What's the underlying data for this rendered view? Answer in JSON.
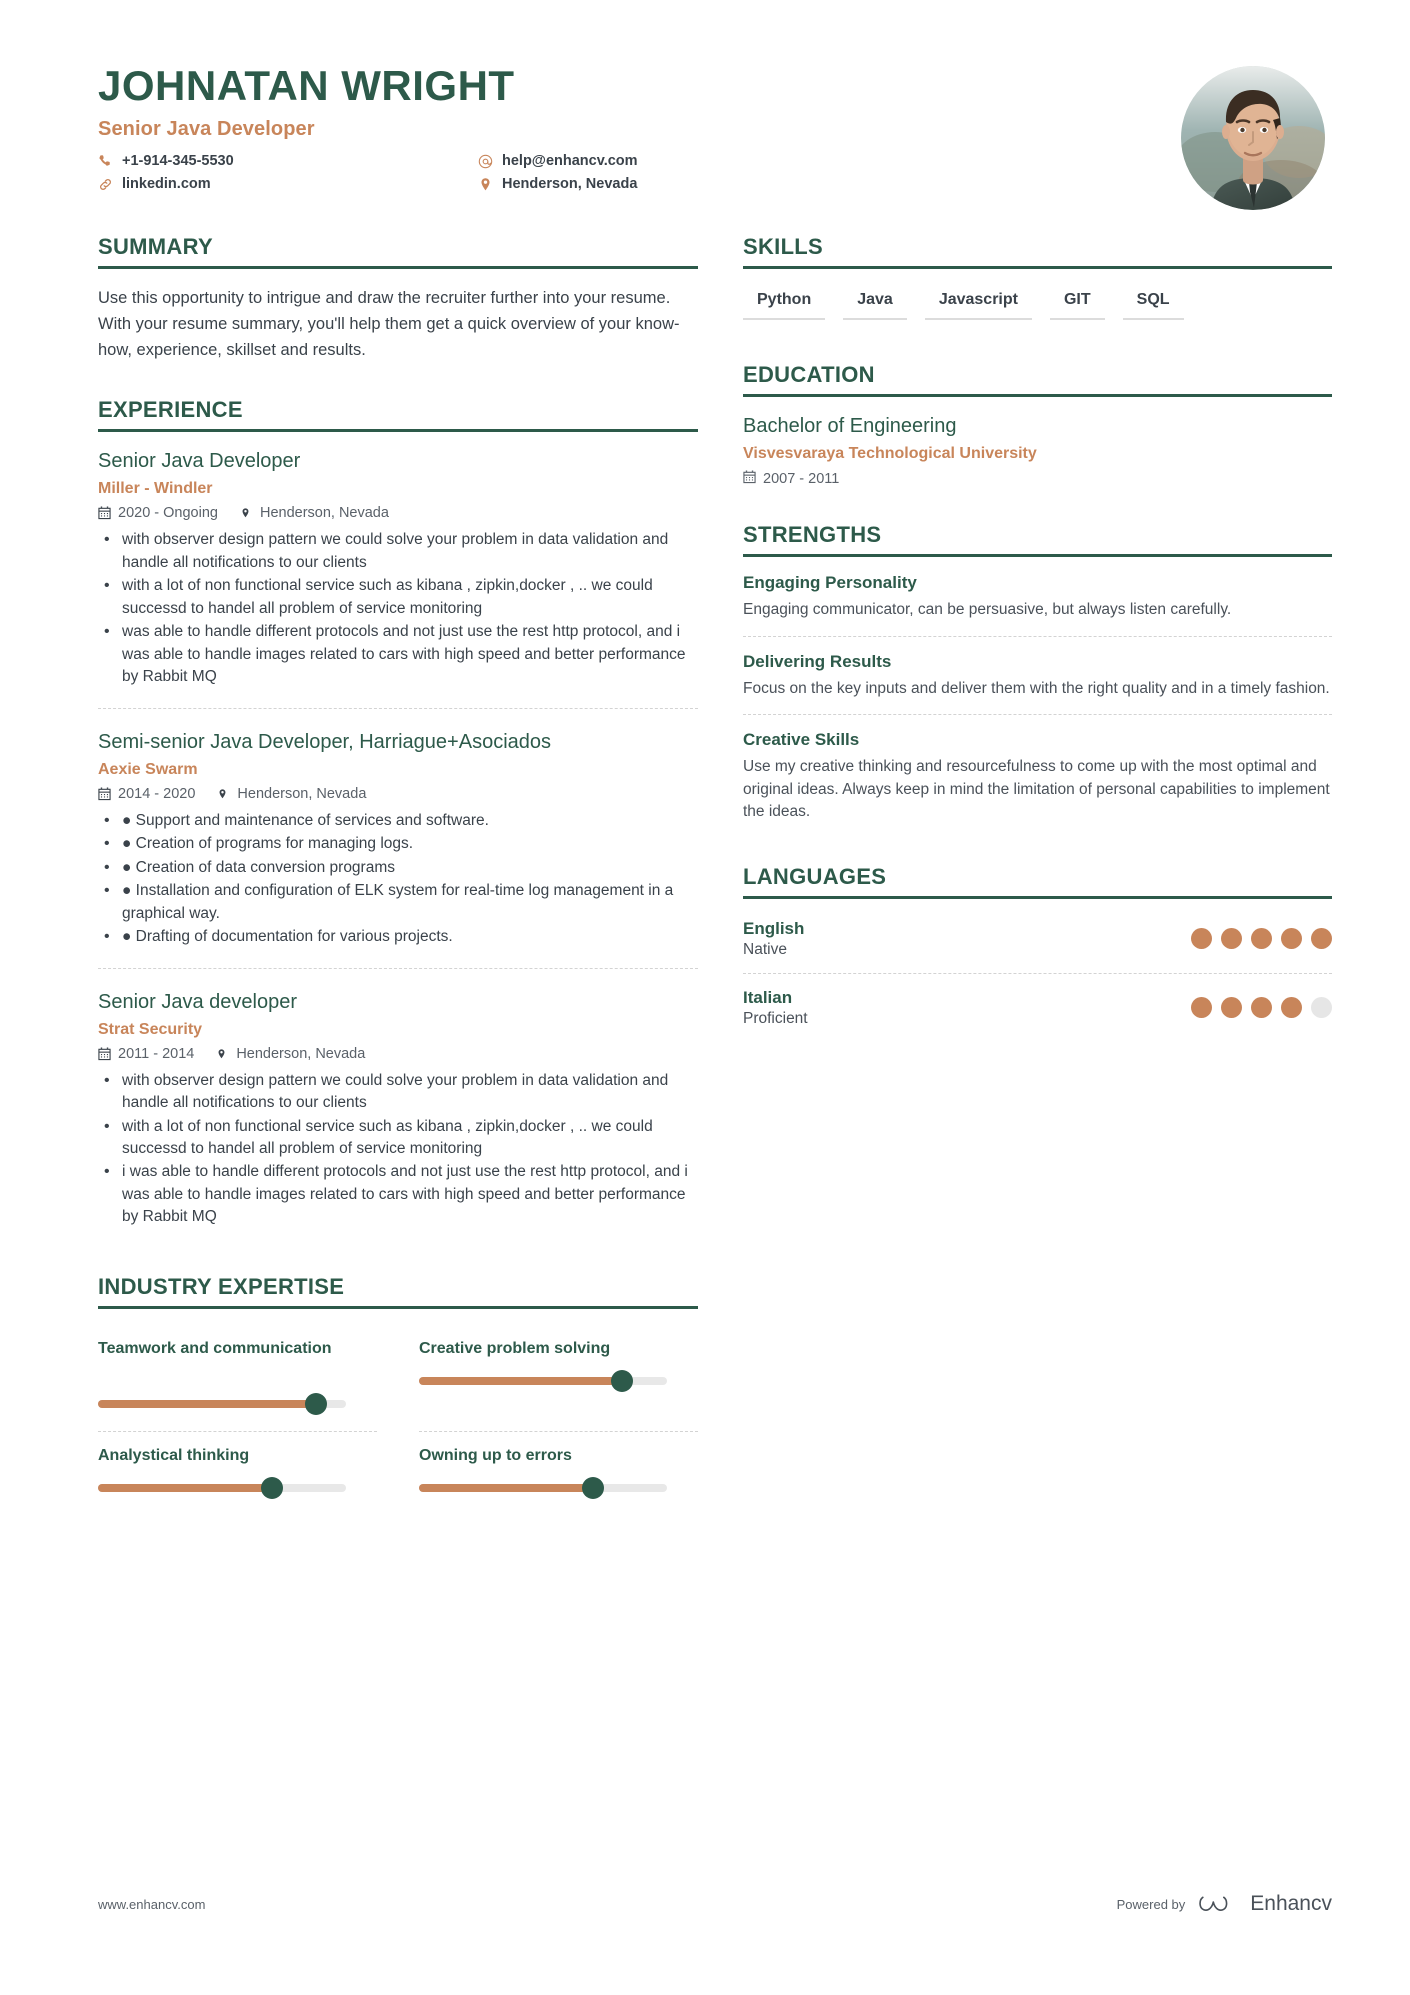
{
  "header": {
    "name": "JOHNATAN WRIGHT",
    "job_title": "Senior Java Developer",
    "contacts": [
      {
        "icon": "phone-icon",
        "text": "+1-914-345-5530"
      },
      {
        "icon": "email-icon",
        "text": "help@enhancv.com"
      },
      {
        "icon": "link-icon",
        "text": "linkedin.com"
      },
      {
        "icon": "location-icon",
        "text": "Henderson, Nevada"
      }
    ]
  },
  "colors": {
    "green": "#2d5a4a",
    "orange": "#c8855a",
    "text": "#3a424a",
    "track": "#e6e6e6"
  },
  "summary": {
    "title": "SUMMARY",
    "text": "Use this opportunity to intrigue and draw the recruiter further into your resume. With your resume summary, you'll help them get a quick overview of your know-how, experience, skillset and results."
  },
  "experience": {
    "title": "EXPERIENCE",
    "items": [
      {
        "role": "Senior Java Developer",
        "company": "Miller - Windler",
        "dates": "2020 - Ongoing",
        "location": "Henderson, Nevada",
        "bullets": [
          "with observer design pattern we could solve your problem in data validation and handle all notifications to our clients",
          "with a lot of non functional service such as kibana , zipkin,docker , .. we could successd to handel all problem of service monitoring",
          "was able to handle different protocols and not just use the rest http protocol, and i was able to handle images related to cars with high speed and better performance by Rabbit MQ"
        ]
      },
      {
        "role": "Semi-senior Java Developer, Harriague+Asociados",
        "company": "Aexie Swarm",
        "dates": "2014 - 2020",
        "location": "Henderson, Nevada",
        "bullets": [
          "● Support and maintenance of services and software.",
          "● Creation of programs for managing logs.",
          "● Creation of data conversion programs",
          "● Installation and configuration of ELK system for real-time log management in a graphical way.",
          "● Drafting of documentation for various projects."
        ]
      },
      {
        "role": "Senior Java developer",
        "company": "Strat Security",
        "dates": "2011 - 2014",
        "location": "Henderson, Nevada",
        "bullets": [
          "with observer design pattern we could solve your problem in data validation and handle all notifications to our clients",
          "with a lot of non functional service such as kibana , zipkin,docker , .. we could successd to handel all problem of service monitoring",
          "i was able to handle different protocols and not just use the rest http protocol, and i was able to handle images related to cars with high speed and better performance by Rabbit MQ"
        ]
      }
    ]
  },
  "industry_expertise": {
    "title": "INDUSTRY EXPERTISE",
    "items": [
      {
        "label": "Teamwork and communication",
        "value": 88
      },
      {
        "label": "Creative problem solving",
        "value": 82
      },
      {
        "label": "Analystical thinking",
        "value": 70
      },
      {
        "label": "Owning up to errors",
        "value": 70
      }
    ]
  },
  "skills": {
    "title": "SKILLS",
    "items": [
      "Python",
      "Java",
      "Javascript",
      "GIT",
      "SQL"
    ]
  },
  "education": {
    "title": "EDUCATION",
    "items": [
      {
        "degree": "Bachelor of Engineering",
        "school": "Visvesvaraya Technological University",
        "dates": "2007 - 2011"
      }
    ]
  },
  "strengths": {
    "title": "STRENGTHS",
    "items": [
      {
        "title": "Engaging Personality",
        "desc": "Engaging communicator, can be persuasive, but always listen carefully."
      },
      {
        "title": "Delivering Results",
        "desc": "Focus on the key inputs and deliver them with the right quality and in a timely fashion."
      },
      {
        "title": "Creative Skills",
        "desc": "Use my creative thinking and resourcefulness to come up with the most optimal and original ideas. Always keep in mind the limitation of personal capabilities to implement the ideas."
      }
    ]
  },
  "languages": {
    "title": "LANGUAGES",
    "items": [
      {
        "name": "English",
        "level": "Native",
        "dots": 5,
        "total": 5
      },
      {
        "name": "Italian",
        "level": "Proficient",
        "dots": 4,
        "total": 5
      }
    ]
  },
  "footer": {
    "website": "www.enhancv.com",
    "powered_by": "Powered by",
    "brand": "Enhancv"
  }
}
